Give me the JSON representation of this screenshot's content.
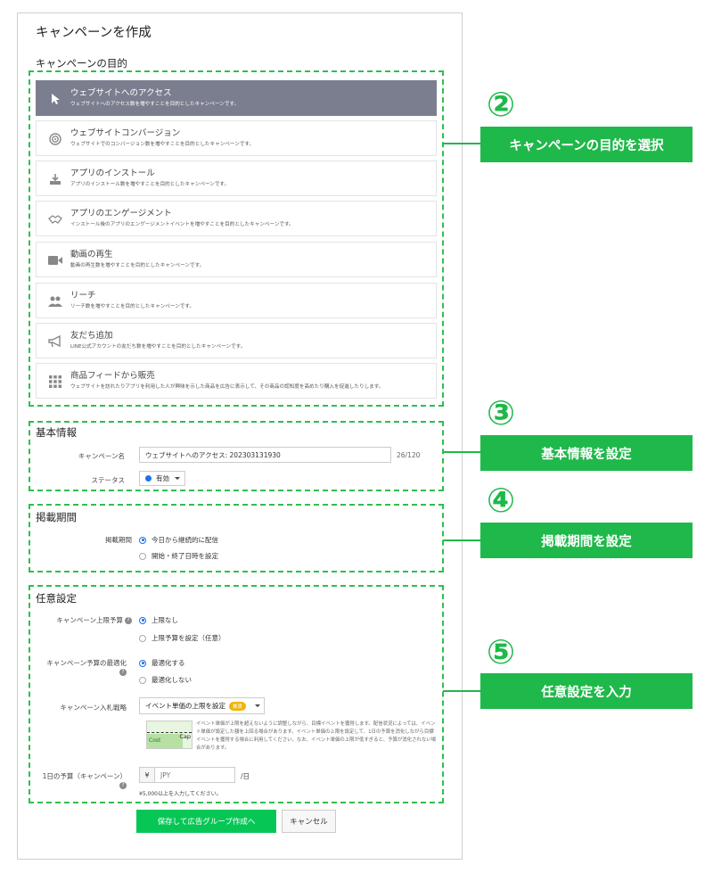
{
  "page_title": "キャンペーンを作成",
  "objective": {
    "heading": "キャンペーンの目的",
    "items": [
      {
        "icon": "cursor-icon",
        "title": "ウェブサイトへのアクセス",
        "desc": "ウェブサイトへのアクセス数を増やすことを目的としたキャンペーンです。",
        "selected": true
      },
      {
        "icon": "target-icon",
        "title": "ウェブサイトコンバージョン",
        "desc": "ウェブサイトでのコンバージョン数を増やすことを目的としたキャンペーンです。",
        "selected": false
      },
      {
        "icon": "download-icon",
        "title": "アプリのインストール",
        "desc": "アプリのインストール数を増やすことを目的としたキャンペーンです。",
        "selected": false
      },
      {
        "icon": "handshake-icon",
        "title": "アプリのエンゲージメント",
        "desc": "インストール後のアプリのエンゲージメントイベントを増やすことを目的としたキャンペーンです。",
        "selected": false
      },
      {
        "icon": "video-icon",
        "title": "動画の再生",
        "desc": "動画の再生数を増やすことを目的としたキャンペーンです。",
        "selected": false
      },
      {
        "icon": "people-icon",
        "title": "リーチ",
        "desc": "リーチ数を増やすことを目的としたキャンペーンです。",
        "selected": false
      },
      {
        "icon": "megaphone-icon",
        "title": "友だち追加",
        "desc": "LINE公式アカウントの友だち数を増やすことを目的としたキャンペーンです。",
        "selected": false
      },
      {
        "icon": "grid-icon",
        "title": "商品フィードから販売",
        "desc": "ウェブサイトを訪れたりアプリを利用した人が興味を示した商品を広告に表示して、その商品の認知度を高めたり購入を促進したりします。",
        "selected": false
      }
    ]
  },
  "basic": {
    "heading": "基本情報",
    "name_label": "キャンペーン名",
    "name_value": "ウェブサイトへのアクセス: 202303131930",
    "name_count": "26/120",
    "status_label": "ステータス",
    "status_value": "有効",
    "status_color": "#1a73e8"
  },
  "period": {
    "heading": "掲載期間",
    "label": "掲載期間",
    "options": [
      "今日から継続的に配信",
      "開始・終了日時を設定"
    ]
  },
  "optional": {
    "heading": "任意設定",
    "cap_label": "キャンペーン上限予算",
    "cap_options": [
      "上限なし",
      "上限予算を設定（任意）"
    ],
    "opt_label": "キャンペーン予算の最適化",
    "opt_options": [
      "最適化する",
      "最適化しない"
    ],
    "bid_label": "キャンペーン入札戦略",
    "bid_value": "イベント単価の上限を設定",
    "bid_badge": "推奨",
    "bid_desc": "イベント単価が上限を超えないように調整しながら、目標イベントを獲得します。配信状況によっては、イベント単価が設定した額を上回る場合があります。イベント単価の上限を設定して、1日の予算を消化しながら目標イベントを獲得する場合に利用してください。なお、イベント単価の上限が低すぎると、予算が消化されない場合があります。",
    "chart_cost": "Cost",
    "chart_cap": "Cap",
    "daily_label": "1日の予算（キャンペーン）",
    "currency": "¥",
    "daily_placeholder": "JPY",
    "per_day": "/日",
    "daily_note": "¥5,000以上を入力してください。"
  },
  "buttons": {
    "save": "保存して広告グループ作成へ",
    "cancel": "キャンセル"
  },
  "annotations": [
    {
      "num": "②",
      "text": "キャンペーンの目的を選択"
    },
    {
      "num": "③",
      "text": "基本情報を設定"
    },
    {
      "num": "④",
      "text": "掲載期間を設定"
    },
    {
      "num": "⑤",
      "text": "任意設定を入力"
    }
  ],
  "colors": {
    "accent": "#1fb84a",
    "primary_button": "#06c755",
    "selected_row": "#7b7e8e"
  }
}
